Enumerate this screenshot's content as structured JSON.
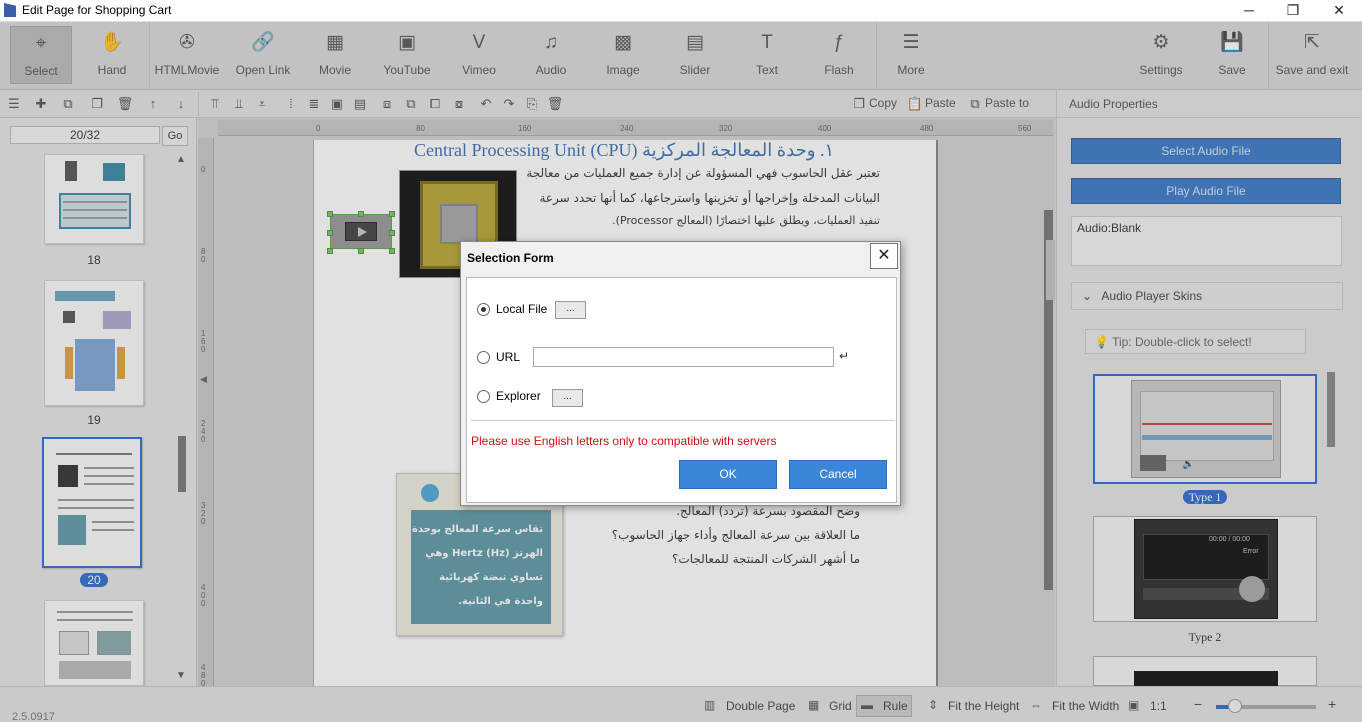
{
  "window": {
    "title": "Edit Page for Shopping Cart",
    "minimize": "─",
    "maximize": "❐",
    "close": "✕"
  },
  "toolbar": {
    "items": [
      {
        "label": "Select",
        "icon": "⌖"
      },
      {
        "label": "Hand",
        "icon": "✋"
      },
      {
        "label": "HTMLMovie",
        "icon": "✇"
      },
      {
        "label": "Open Link",
        "icon": "🔗"
      },
      {
        "label": "Movie",
        "icon": "▦"
      },
      {
        "label": "YouTube",
        "icon": "▣"
      },
      {
        "label": "Vimeo",
        "icon": "V"
      },
      {
        "label": "Audio",
        "icon": "♫"
      },
      {
        "label": "Image",
        "icon": "▩"
      },
      {
        "label": "Slider",
        "icon": "▤"
      },
      {
        "label": "Text",
        "icon": "T"
      },
      {
        "label": "Flash",
        "icon": "ƒ"
      },
      {
        "label": "More",
        "icon": "☰"
      }
    ],
    "right_items": [
      {
        "label": "Settings",
        "icon": "⚙"
      },
      {
        "label": "Save",
        "icon": "💾"
      },
      {
        "label": "Save and exit",
        "icon": "⇱"
      }
    ]
  },
  "toolbar2": {
    "copy": "Copy",
    "paste": "Paste",
    "paste_to": "Paste to"
  },
  "left": {
    "page_input": "20/32",
    "go": "Go",
    "pages": [
      "18",
      "19",
      "20"
    ]
  },
  "ruler": {
    "h": [
      "0",
      "80",
      "160",
      "240",
      "320",
      "400",
      "480",
      "560"
    ]
  },
  "page_content": {
    "heading": "Central Processing Unit (CPU) ١. وحدة المعالجة المركزية",
    "p1": "تعتبر عقل الحاسوب فهي المسؤولة عن إدارة جميع العمليات من معالجة",
    "p2": "البيانات المدخلة وإخراجها أو تخزينها واسترجاعها، كما أنها تحدد سرعة",
    "p3": "تنفيذ العمليات، ويطلق عليها اختصارًا (المعالج Processor).",
    "q1": "وضح المقصود بسرعة (تردد) المعالج.",
    "q2": "ما العلاقة بين سرعة المعالج وأداء جهاز الحاسوب؟",
    "q3": "ما أشهر الشركات المنتجة للمعالجات؟",
    "info1": "تقاس سرعة المعالج بوحدة",
    "info2": "الهرتز (Hz) Hertz وهي",
    "info3": "تساوي نبضة كهربائية",
    "info4": "واحدة في الثانية."
  },
  "right": {
    "header": "Audio Properties",
    "select_audio": "Select Audio File",
    "play_audio": "Play Audio File",
    "audio_value": "Audio:Blank",
    "skins_header": "Audio Player Skins",
    "tip": "Tip: Double-click to select!",
    "skins": [
      "Type 1",
      "Type 2"
    ],
    "skin2_time": "00:00 / 00:00",
    "skin2_status": "Error"
  },
  "status": {
    "version": "2.5.0917",
    "double_page": "Double Page",
    "grid": "Grid",
    "rule": "Rule",
    "fit_height": "Fit the Height",
    "fit_width": "Fit the Width",
    "one_to_one": "1:1",
    "zoom_level": 0.2
  },
  "dialog": {
    "title": "Selection Form",
    "close": "✕",
    "local_file": "Local File",
    "url": "URL",
    "url_value": "",
    "explorer": "Explorer",
    "browse": "...",
    "enter_icon": "↵",
    "warning": "Please use English letters only to compatible with servers",
    "ok": "OK",
    "cancel": "Cancel"
  }
}
